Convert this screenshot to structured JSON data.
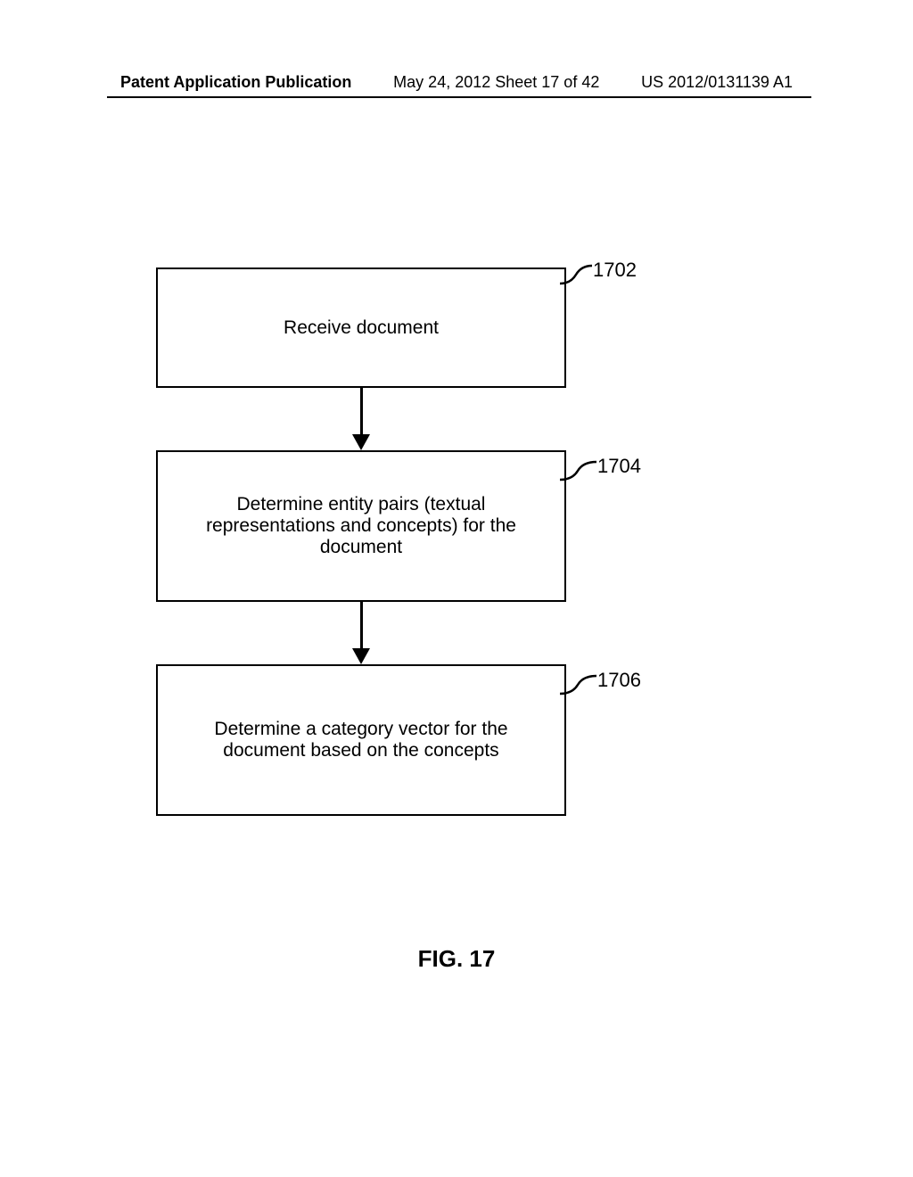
{
  "header": {
    "left": "Patent Application Publication",
    "center": "May 24, 2012  Sheet 17 of 42",
    "right": "US 2012/0131139 A1"
  },
  "flowchart": {
    "box1": {
      "text": "Receive document",
      "ref": "1702"
    },
    "box2": {
      "text": "Determine entity pairs (textual representations and concepts) for the document",
      "ref": "1704"
    },
    "box3": {
      "text": "Determine a category vector for the document based on the concepts",
      "ref": "1706"
    }
  },
  "figure_label": "FIG. 17"
}
